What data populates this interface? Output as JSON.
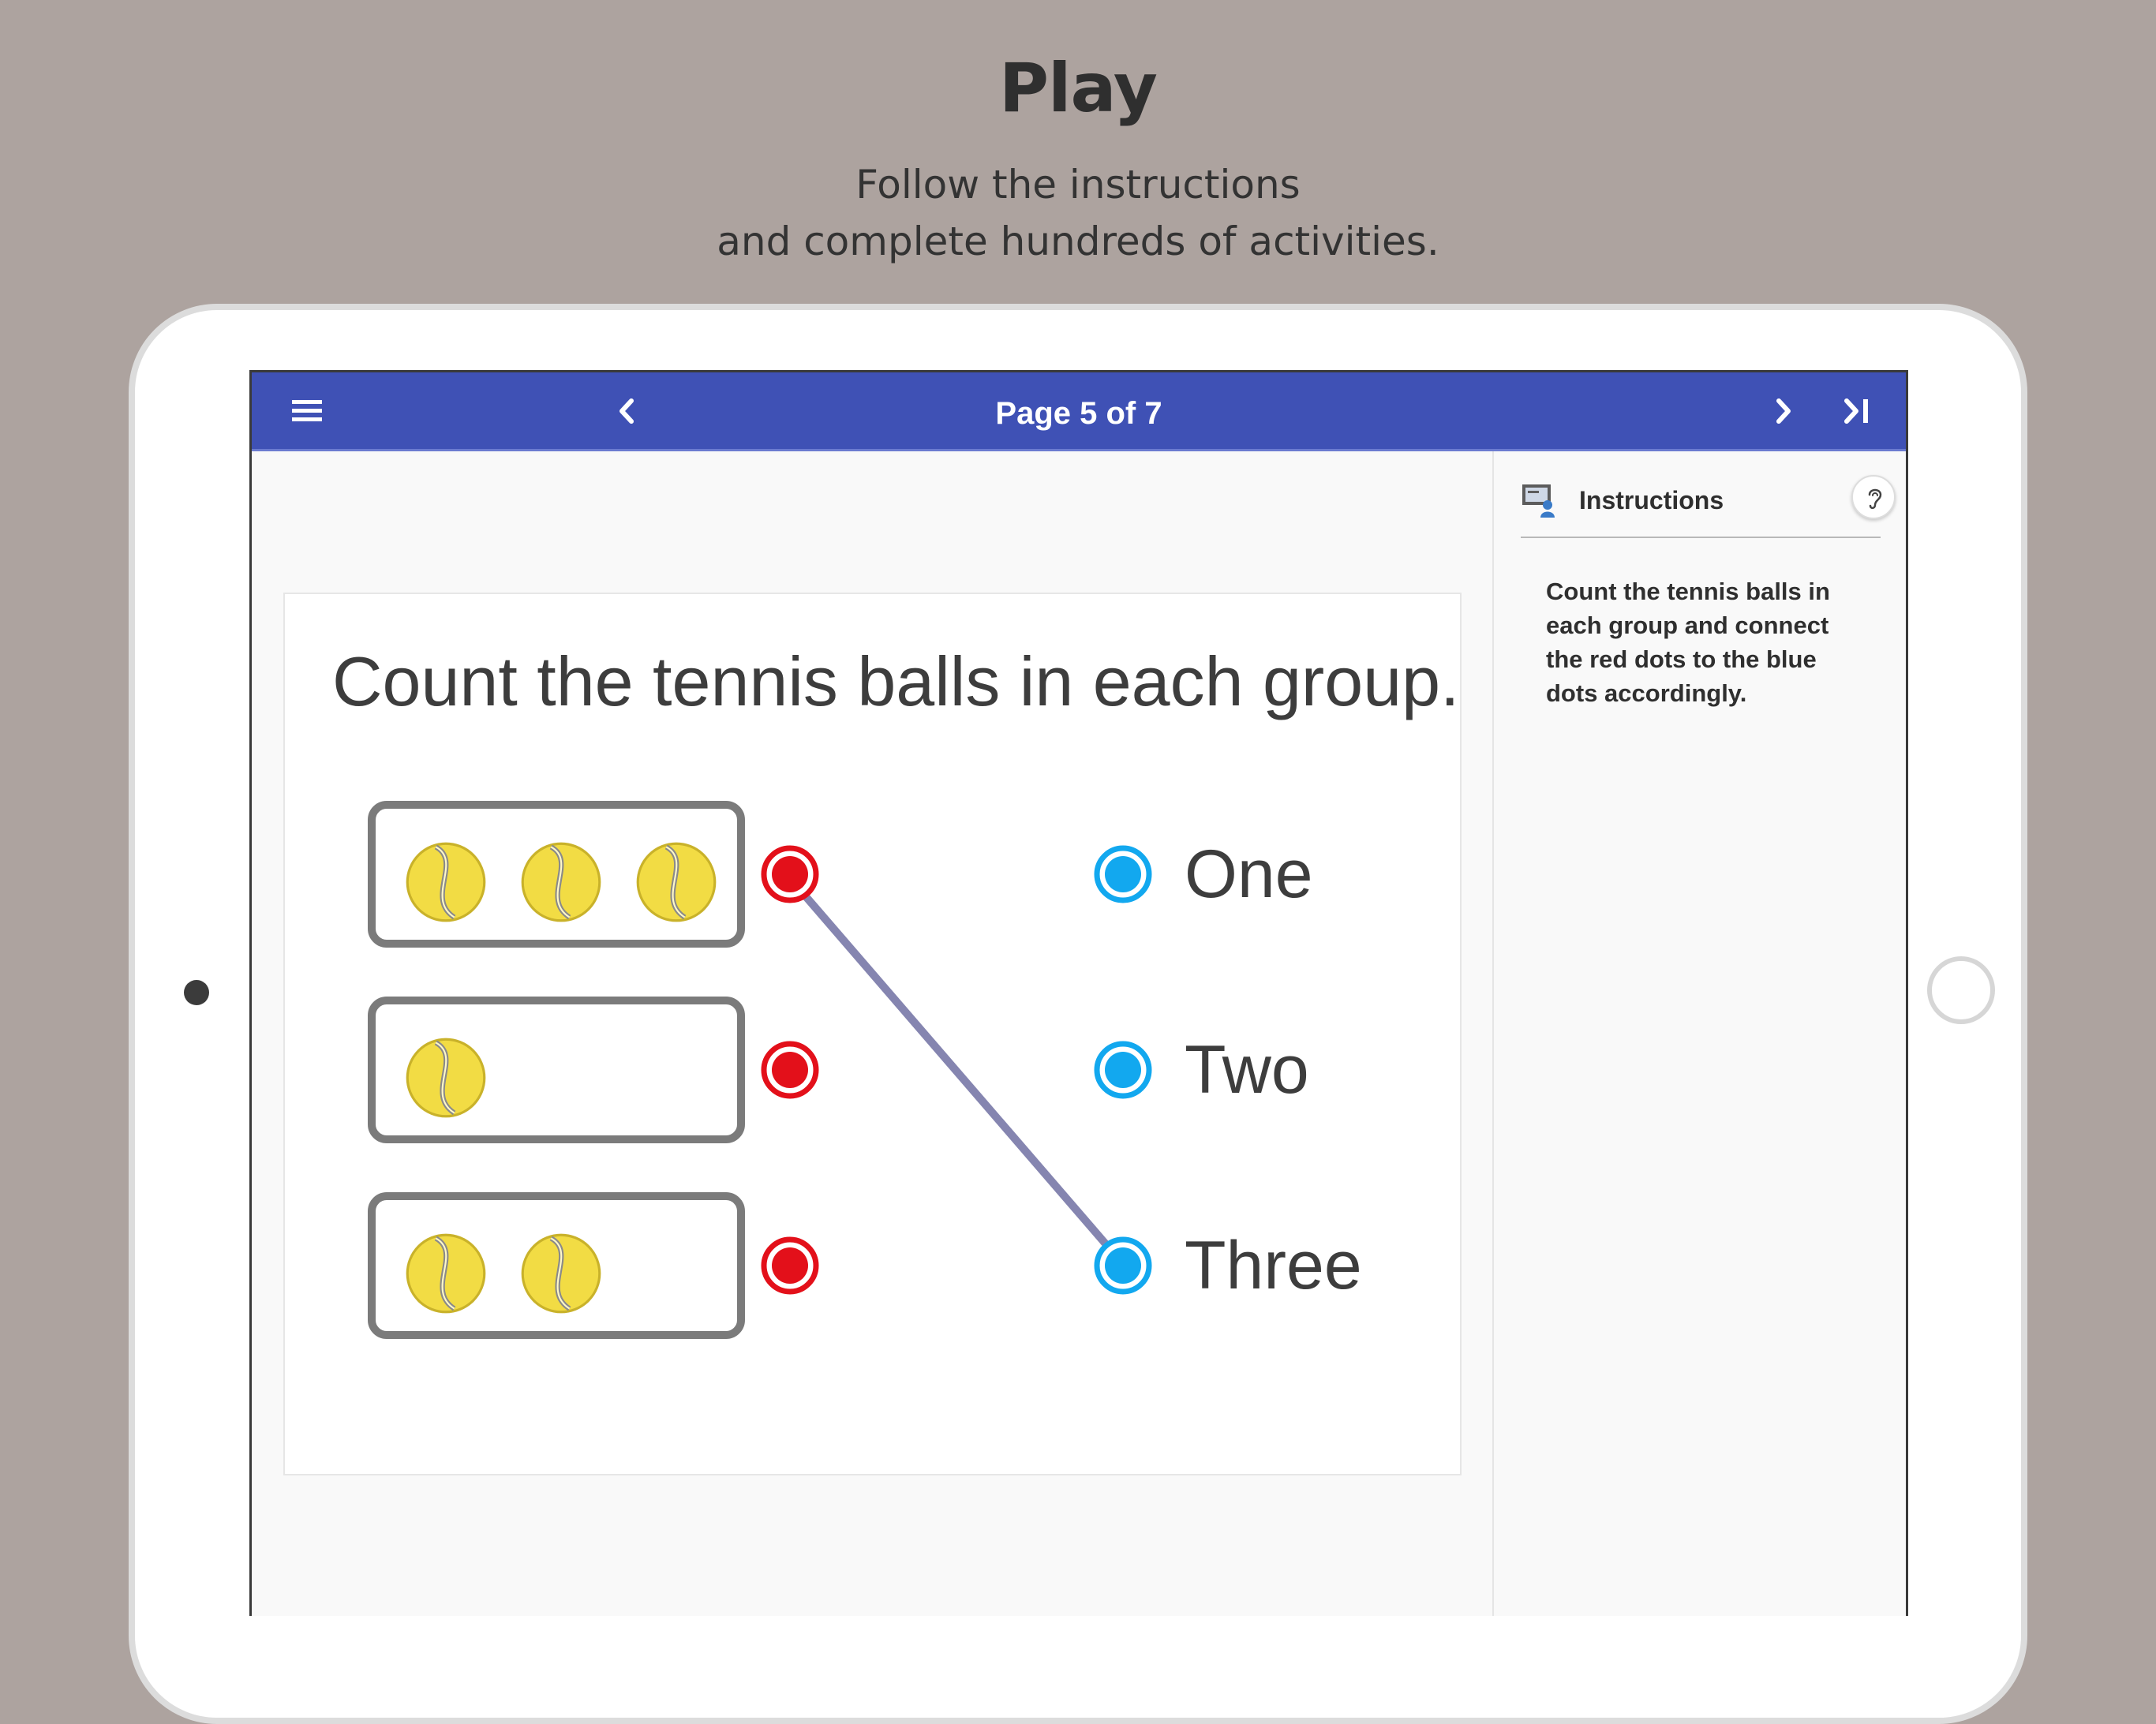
{
  "promo": {
    "title": "Play",
    "subtitle_line1": "Follow the instructions",
    "subtitle_line2": "and complete hundreds of activities."
  },
  "app_bar": {
    "title": "Page 5 of 7",
    "color": "#3f51b5",
    "icons": [
      "menu-icon",
      "chevron-left-icon",
      "chevron-right-icon",
      "skip-to-end-icon"
    ]
  },
  "instructions_panel": {
    "header": "Instructions",
    "text": "Count the tennis balls in each group and connect the red dots to the blue dots accordingly.",
    "icons": [
      "instructions-board-icon",
      "ear-listen-icon"
    ]
  },
  "activity": {
    "question": "Count the tennis balls in each group.",
    "groups": [
      {
        "ball_count": 3
      },
      {
        "ball_count": 1
      },
      {
        "ball_count": 2
      }
    ],
    "answers": [
      "One",
      "Two",
      "Three"
    ],
    "connections": [
      {
        "from_group": 1,
        "to_answer": "Three"
      }
    ],
    "colors": {
      "red_dot": "#e3101a",
      "blue_dot": "#12a8ef",
      "connection_line": "#8585b0",
      "box_border": "#7b7b7b",
      "ball": "#f2dc44"
    }
  }
}
